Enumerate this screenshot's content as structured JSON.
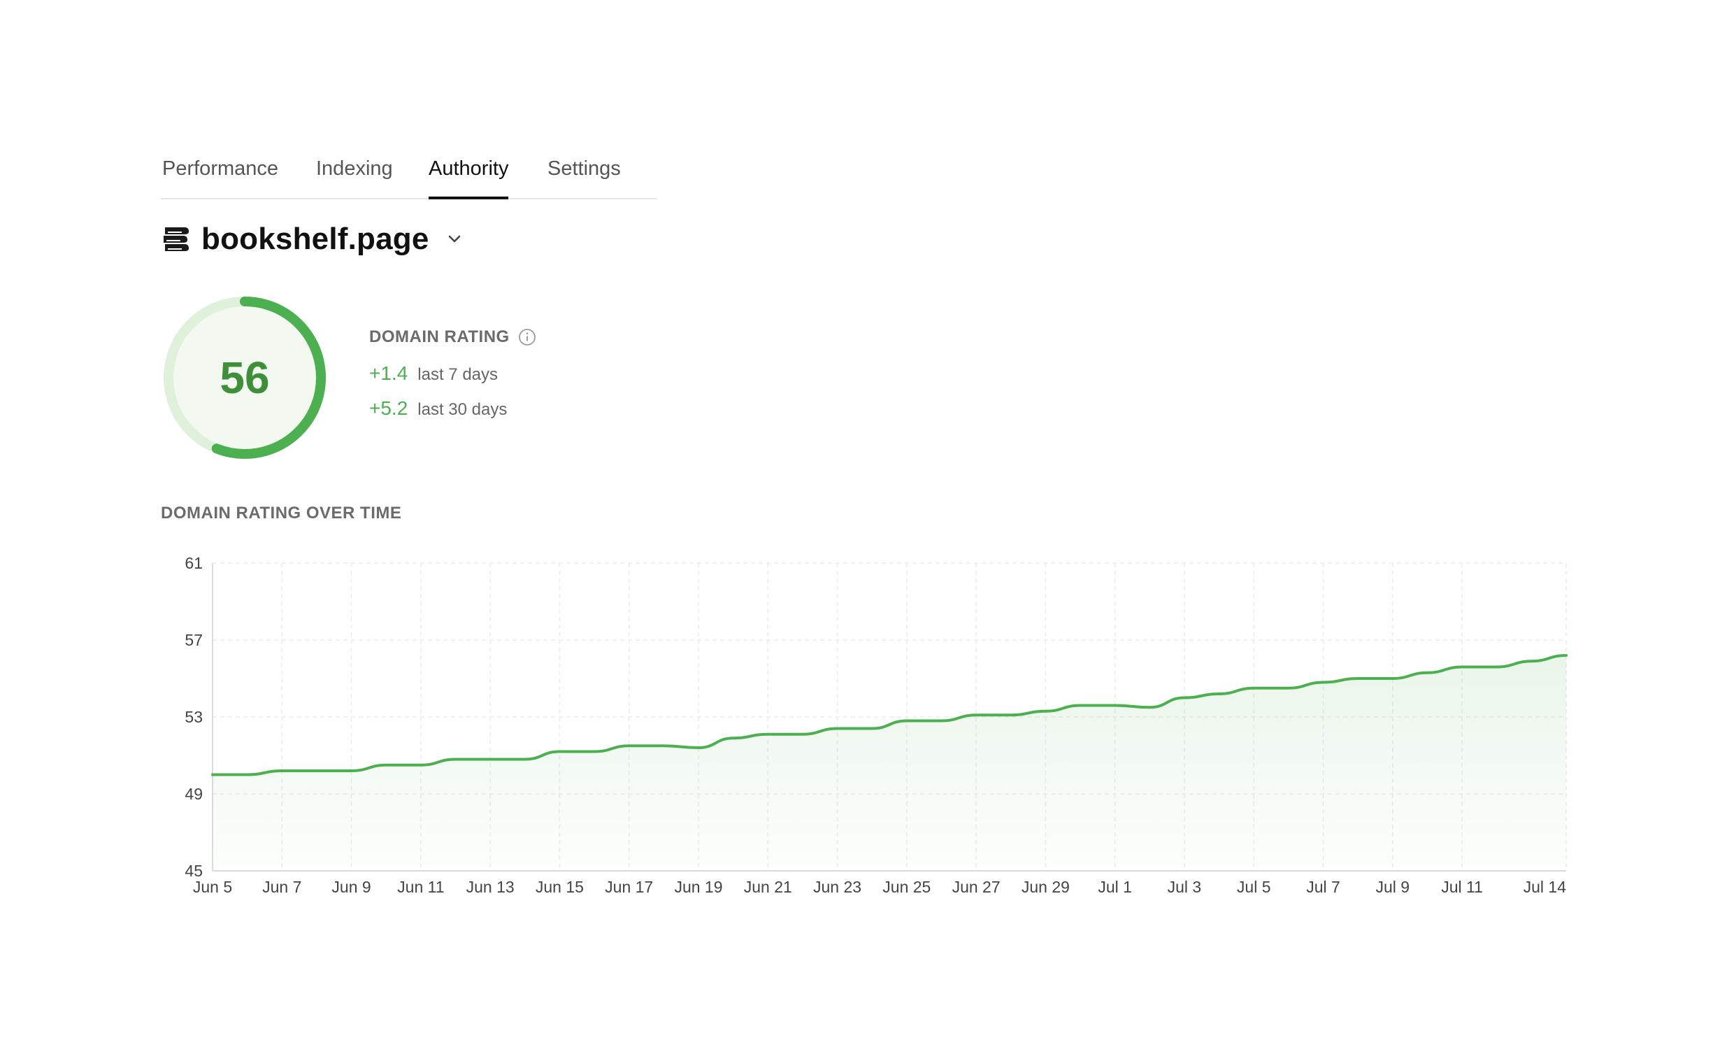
{
  "tabs": [
    {
      "label": "Performance",
      "active": false
    },
    {
      "label": "Indexing",
      "active": false
    },
    {
      "label": "Authority",
      "active": true
    },
    {
      "label": "Settings",
      "active": false
    }
  ],
  "site": {
    "domain": "bookshelf.page",
    "icon": "books-icon"
  },
  "rating": {
    "title": "DOMAIN RATING",
    "value": "56",
    "max": 100,
    "delta_7": "+1.4",
    "delta_7_label": "last 7 days",
    "delta_30": "+5.2",
    "delta_30_label": "last 30 days"
  },
  "colors": {
    "accent": "#4cb050",
    "accent_dark": "#3f8f3a",
    "track": "#dff0db"
  },
  "chart": {
    "title": "DOMAIN RATING OVER TIME"
  },
  "chart_data": {
    "type": "area",
    "title": "DOMAIN RATING OVER TIME",
    "xlabel": "",
    "ylabel": "",
    "ylim": [
      45,
      61
    ],
    "yticks": [
      45,
      49,
      53,
      57,
      61
    ],
    "grid": true,
    "x": [
      "Jun 5",
      "Jun 6",
      "Jun 7",
      "Jun 8",
      "Jun 9",
      "Jun 10",
      "Jun 11",
      "Jun 12",
      "Jun 13",
      "Jun 14",
      "Jun 15",
      "Jun 16",
      "Jun 17",
      "Jun 18",
      "Jun 19",
      "Jun 20",
      "Jun 21",
      "Jun 22",
      "Jun 23",
      "Jun 24",
      "Jun 25",
      "Jun 26",
      "Jun 27",
      "Jun 28",
      "Jun 29",
      "Jun 30",
      "Jul 1",
      "Jul 2",
      "Jul 3",
      "Jul 4",
      "Jul 5",
      "Jul 6",
      "Jul 7",
      "Jul 8",
      "Jul 9",
      "Jul 10",
      "Jul 11",
      "Jul 12",
      "Jul 13",
      "Jul 14"
    ],
    "xtick_labels": [
      "Jun 5",
      "Jun 7",
      "Jun 9",
      "Jun 11",
      "Jun 13",
      "Jun 15",
      "Jun 17",
      "Jun 19",
      "Jun 21",
      "Jun 23",
      "Jun 25",
      "Jun 27",
      "Jun 29",
      "Jul 1",
      "Jul 3",
      "Jul 5",
      "Jul 7",
      "Jul 9",
      "Jul 11",
      "Jul 14"
    ],
    "series": [
      {
        "values": [
          50.0,
          50.0,
          50.2,
          50.2,
          50.2,
          50.5,
          50.5,
          50.8,
          50.8,
          50.8,
          51.2,
          51.2,
          51.5,
          51.5,
          51.4,
          51.9,
          52.1,
          52.1,
          52.4,
          52.4,
          52.8,
          52.8,
          53.1,
          53.1,
          53.3,
          53.6,
          53.6,
          53.5,
          54.0,
          54.2,
          54.5,
          54.5,
          54.8,
          55.0,
          55.0,
          55.3,
          55.6,
          55.6,
          55.9,
          56.2
        ]
      }
    ]
  }
}
